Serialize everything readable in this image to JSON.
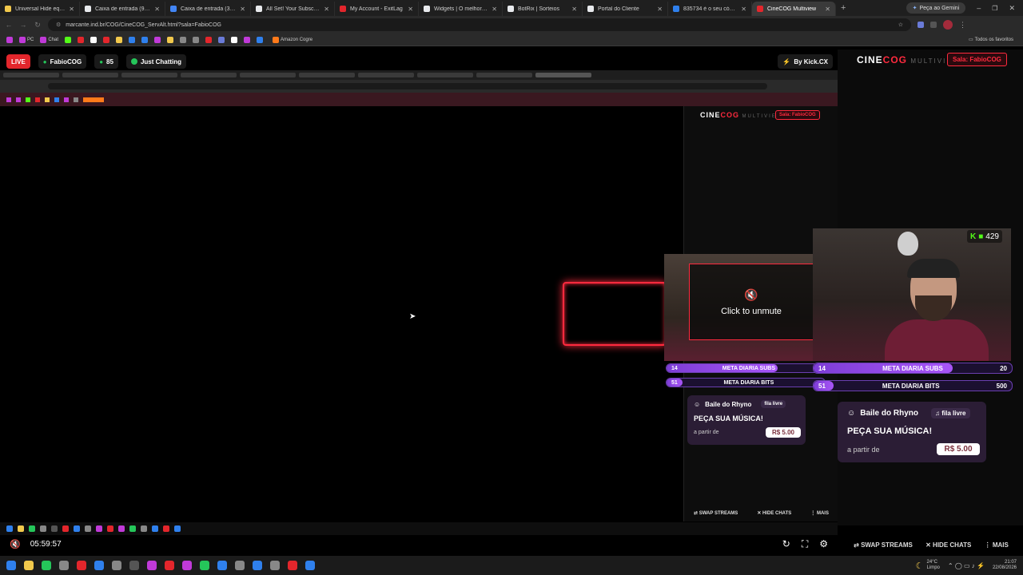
{
  "browser": {
    "tabs": [
      {
        "label": "Universal Hide equipped S",
        "color": "#f2c94c"
      },
      {
        "label": "Caixa de entrada (917) - Ex",
        "color": "#e8eaed"
      },
      {
        "label": "Caixa de entrada (38) - E-m",
        "color": "#4285f4"
      },
      {
        "label": "All Set! Your Subscription I",
        "color": "#e8eaed"
      },
      {
        "label": "My Account - ExitLag",
        "color": "#e3262c"
      },
      {
        "label": "Widgets | O melhor softw",
        "color": "#e8eaed"
      },
      {
        "label": "BotRix | Sorteios",
        "color": "#e8eaed"
      },
      {
        "label": "Portal do Cliente",
        "color": "#e8eaed"
      },
      {
        "label": "835734 é o seu código de",
        "color": "#2f80ed"
      },
      {
        "label": "CineCOG Multiview",
        "color": "#e3262c"
      }
    ],
    "gemini_button": "Peça ao Gemini",
    "url": "marcante.ind.br/COG/CineCOG_ServAlt.html?sala=FabioCOG",
    "bookmarks": [
      "PC",
      "Chat",
      "Amazon Cogre"
    ],
    "all_bookmarks": "Todos os favoritos"
  },
  "stream": {
    "live_label": "LIVE",
    "channel": "FabioCOG",
    "viewers": "85",
    "category": "Just Chatting",
    "by": "By Kick.CX"
  },
  "brand": {
    "cine": "CINE",
    "cog": "COG",
    "multiview": "MULTIVIEW",
    "sala": "Sala: FabioCOG"
  },
  "overlay": {
    "kick_count": "429",
    "click_to_unmute": "Click to unmute",
    "goals": [
      {
        "label": "META DIARIA SUBS",
        "current": "14",
        "target": "20",
        "progress": 0.7
      },
      {
        "label": "META DIARIA BITS",
        "current": "51",
        "target": "500",
        "progress": 0.102
      }
    ],
    "music_card": {
      "title": "Baile do Rhyno",
      "fila": "fila livre",
      "cta": "PEÇA SUA MÚSICA!",
      "from": "a partir de",
      "price": "R$ 5.00"
    }
  },
  "actions": {
    "swap": "SWAP STREAMS",
    "hide": "HIDE CHATS",
    "more": "MAIS"
  },
  "player": {
    "time": "05:59:57"
  },
  "system": {
    "weather_temp": "24°C",
    "weather_desc": "Limpo",
    "clock_time": "21:07",
    "clock_date": "22/08/2026"
  }
}
